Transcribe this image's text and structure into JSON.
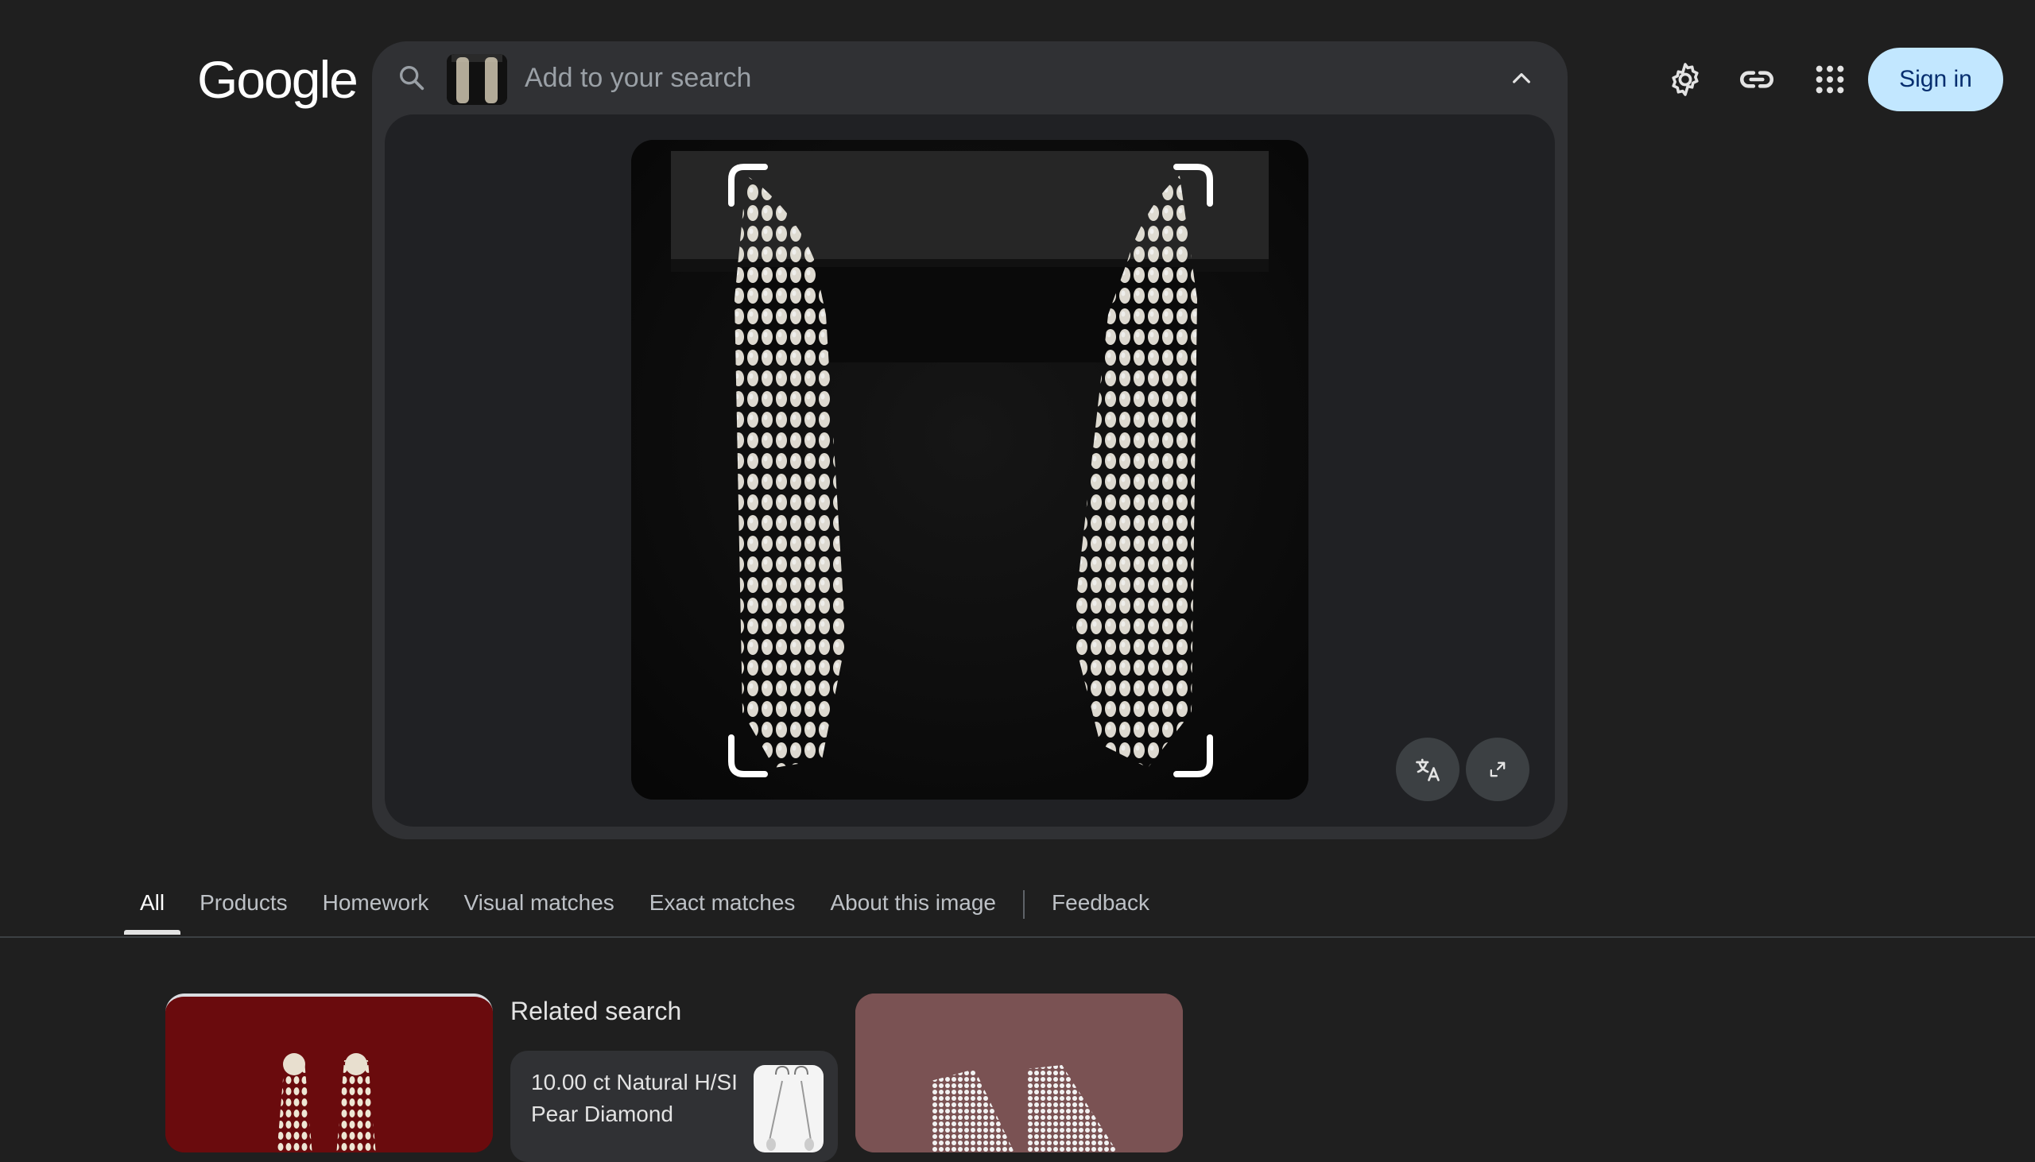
{
  "logo": "Google",
  "search": {
    "placeholder": "Add to your search",
    "thumbnail_icon": "earrings-thumbnail",
    "collapse_icon": "chevron-up-icon"
  },
  "header": {
    "settings_icon": "gear-icon",
    "link_icon": "link-icon",
    "apps_icon": "apps-grid-icon",
    "signin_label": "Sign in"
  },
  "lens": {
    "translate_icon": "translate-icon",
    "expand_icon": "expand-icon"
  },
  "tabs": [
    {
      "label": "All",
      "active": true
    },
    {
      "label": "Products"
    },
    {
      "label": "Homework"
    },
    {
      "label": "Visual matches"
    },
    {
      "label": "Exact matches"
    },
    {
      "label": "About this image"
    },
    {
      "label": "Feedback"
    }
  ],
  "results": {
    "related_title": "Related search",
    "related_item": "10.00 ct Natural H/SI Pear Diamond"
  },
  "colors": {
    "background": "#1f1f1f",
    "surface": "#303134",
    "signin_bg": "#c2e7ff",
    "signin_text": "#062e6f"
  }
}
